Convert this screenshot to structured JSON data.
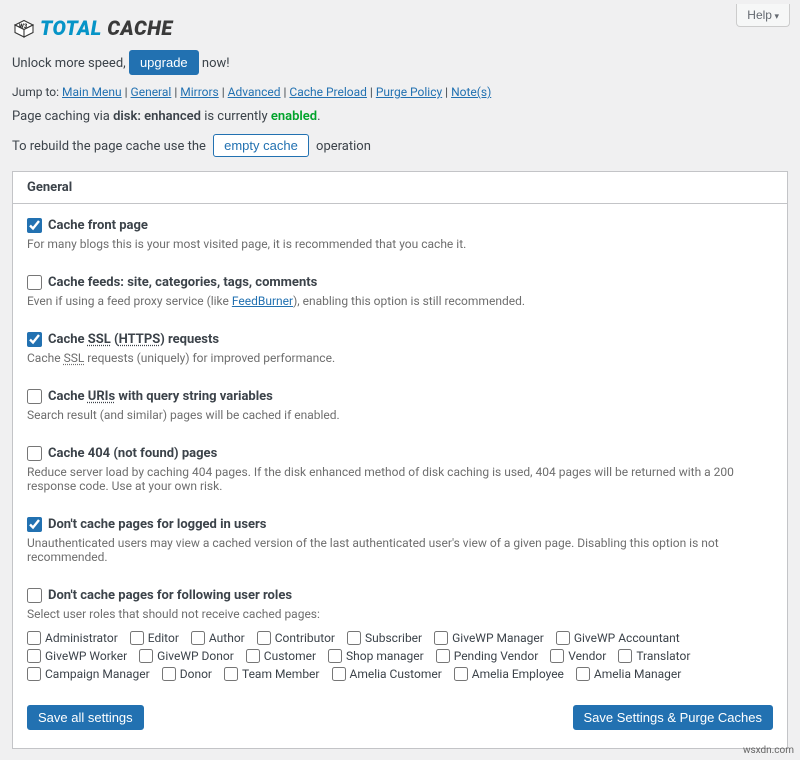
{
  "help_label": "Help",
  "logo": {
    "total": "TOTAL",
    "cache": "CACHE"
  },
  "unlock": {
    "prefix": "Unlock more speed,",
    "button": "upgrade",
    "suffix": "now!"
  },
  "jump": {
    "label": "Jump to:",
    "items": [
      "Main Menu",
      "General",
      "Mirrors",
      "Advanced",
      "Cache Preload",
      "Purge Policy",
      "Note(s)"
    ]
  },
  "status": {
    "prefix": "Page caching via",
    "method": "disk: enhanced",
    "middle": "is currently",
    "state": "enabled",
    "suffix": "."
  },
  "rebuild": {
    "prefix": "To rebuild the page cache use the",
    "button": "empty cache",
    "suffix": "operation"
  },
  "panel": {
    "title": "General"
  },
  "options": [
    {
      "id": "front",
      "label": "Cache front page",
      "checked": true,
      "desc": "For many blogs this is your most visited page, it is recommended that you cache it."
    },
    {
      "id": "feeds",
      "label": "Cache feeds: site, categories, tags, comments",
      "checked": false,
      "desc": "Even if using a feed proxy service (like FeedBurner), enabling this option is still recommended.",
      "link": "FeedBurner"
    },
    {
      "id": "ssl",
      "label_html": "Cache <span class='dotted'>SSL</span> (<span class='dotted'>HTTPS</span>) requests",
      "checked": true,
      "desc_html": "Cache <span class='dotted'>SSL</span> requests (uniquely) for improved performance."
    },
    {
      "id": "query",
      "label_html": "Cache <span class='dotted'>URIs</span> with query string variables",
      "checked": false,
      "desc": "Search result (and similar) pages will be cached if enabled."
    },
    {
      "id": "404",
      "label": "Cache 404 (not found) pages",
      "checked": false,
      "desc": "Reduce server load by caching 404 pages. If the disk enhanced method of disk caching is used, 404 pages will be returned with a 200 response code. Use at your own risk."
    },
    {
      "id": "logged",
      "label": "Don't cache pages for logged in users",
      "checked": true,
      "desc": "Unauthenticated users may view a cached version of the last authenticated user's view of a given page. Disabling this option is not recommended."
    },
    {
      "id": "roles",
      "label": "Don't cache pages for following user roles",
      "checked": false,
      "desc": "Select user roles that should not receive cached pages:"
    }
  ],
  "roles": [
    "Administrator",
    "Editor",
    "Author",
    "Contributor",
    "Subscriber",
    "GiveWP Manager",
    "GiveWP Accountant",
    "GiveWP Worker",
    "GiveWP Donor",
    "Customer",
    "Shop manager",
    "Pending Vendor",
    "Vendor",
    "Translator",
    "Campaign Manager",
    "Donor",
    "Team Member",
    "Amelia Customer",
    "Amelia Employee",
    "Amelia Manager"
  ],
  "buttons": {
    "save_all": "Save all settings",
    "save_purge": "Save Settings & Purge Caches"
  },
  "attrib": "wsxdn.com"
}
